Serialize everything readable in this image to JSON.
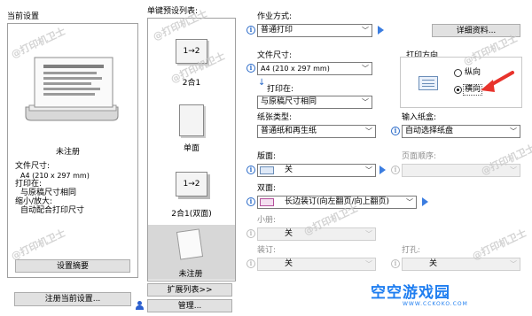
{
  "current_settings": {
    "title": "当前设置",
    "name": "未注册",
    "paper_size_label": "文件尺寸:",
    "paper_size_value": "A4 (210 x 297 mm)",
    "print_on_label": "打印在:",
    "print_on_value": "与原稿尺寸相同",
    "zoom_label": "缩小/放大:",
    "zoom_value": "自动配合打印尺寸",
    "summary_button": "设置摘要",
    "register_button": "注册当前设置..."
  },
  "presets": {
    "title": "单键预设列表:",
    "items": [
      {
        "thumb": "1→2",
        "label": "2合1"
      },
      {
        "thumb": "",
        "label": "单面"
      },
      {
        "thumb": "1→2",
        "label": "2合1(双面)"
      },
      {
        "thumb": "",
        "label": "未注册"
      }
    ],
    "expand_button": "扩展列表>>",
    "manage_button": "管理..."
  },
  "settings": {
    "print_method_label": "作业方式:",
    "print_method_value": "普通打印",
    "details_button": "详细资料...",
    "paper_size_label": "文件尺寸:",
    "paper_size_value": "A4 (210 x 297 mm)",
    "print_on_label": "打印在:",
    "print_on_value": "与原稿尺寸相同",
    "orientation_title": "打印方向",
    "portrait_label": "纵向",
    "landscape_label": "横向",
    "paper_type_label": "纸张类型:",
    "paper_type_value": "普通纸和再生纸",
    "input_tray_label": "输入纸盒:",
    "input_tray_value": "自动选择纸盘",
    "layout_label": "版面:",
    "layout_value": "关",
    "page_order_label": "页面顺序:",
    "duplex_label": "双面:",
    "duplex_value": "长边装订(向左翻页/向上翻页)",
    "booklet_label": "小册:",
    "booklet_value": "关",
    "staple_label": "装订:",
    "staple_value": "关",
    "punch_label": "打孔:",
    "punch_value": "关"
  },
  "watermark": "@打印机卫士",
  "brand": {
    "name": "空空游戏园",
    "url": "WWW.CCKOKO.COM"
  },
  "colors": {
    "accent": "#2a6ac8",
    "arrow": "#e8332c",
    "brand_blue": "#1f7ef0",
    "brand_orange": "#f5a623"
  }
}
